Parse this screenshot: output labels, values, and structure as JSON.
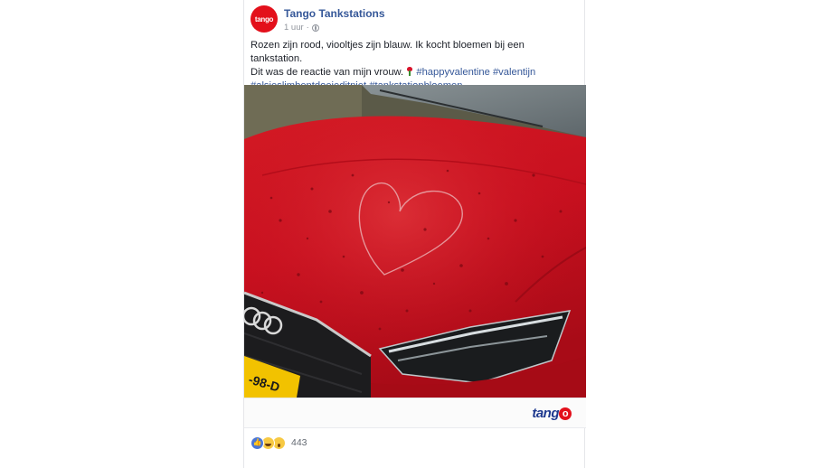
{
  "post": {
    "page_name": "Tango Tankstations",
    "avatar_text": "tango",
    "timestamp": "1 uur",
    "separator": "·",
    "privacy_icon": "globe-icon",
    "text_line1": "Rozen zijn rood, viooltjes zijn blauw. Ik kocht bloemen bij een tankstation.",
    "text_line2_prefix": "Dit was de reactie van mijn vrouw.",
    "emoji_icon": "rose-icon",
    "hashtags": [
      "#happyvalentine",
      "#valentijn",
      "#alsjeslimbentdoejeditniet",
      "#tankstationbloemen"
    ],
    "photo_description_icon": "car-hood-heart-image",
    "link_brand_text_pre": "tang",
    "link_brand_text_o": "o",
    "reactions": {
      "icons": [
        "like-icon",
        "haha-icon",
        "wow-icon"
      ],
      "count": "443"
    }
  },
  "colors": {
    "brand_red": "#e3101b",
    "link_blue": "#365899",
    "car_red": "#c8101f"
  }
}
